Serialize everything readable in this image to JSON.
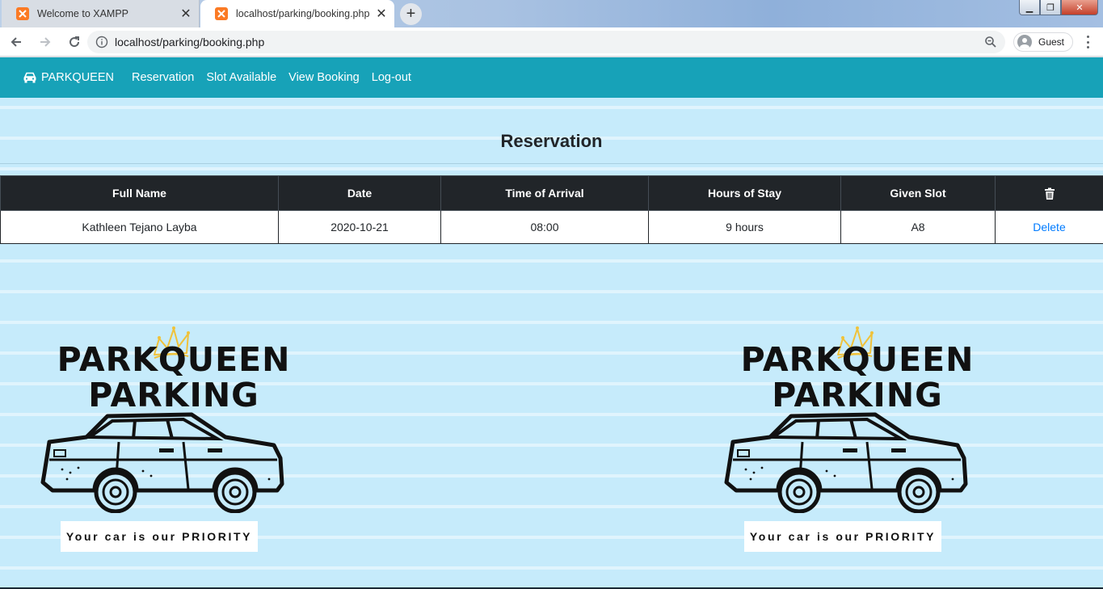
{
  "browser": {
    "tabs": [
      {
        "title": "Welcome to XAMPP",
        "active": false
      },
      {
        "title": "localhost/parking/booking.php",
        "active": true
      }
    ],
    "url": "localhost/parking/booking.php",
    "profile_label": "Guest"
  },
  "navbar": {
    "brand": "PARKQUEEN",
    "links": [
      "Reservation",
      "Slot Available",
      "View Booking",
      "Log-out"
    ],
    "color": "#17a2b8"
  },
  "page": {
    "title": "Reservation"
  },
  "table": {
    "headers": [
      "Full Name",
      "Date",
      "Time of Arrival",
      "Hours of Stay",
      "Given Slot"
    ],
    "rows": [
      {
        "full_name": "Kathleen Tejano Layba",
        "date": "2020-10-21",
        "time_of_arrival": "08:00",
        "hours_of_stay": "9 hours",
        "given_slot": "A8",
        "action": "Delete"
      }
    ]
  },
  "logo": {
    "line1": "PARKQUEEN",
    "line2": "PARKING",
    "tagline": "Your car is our PRIORITY"
  },
  "colors": {
    "page_background": "#c6ebfb",
    "table_header": "#212529",
    "link": "#007bff",
    "crown": "#f0c23a"
  }
}
